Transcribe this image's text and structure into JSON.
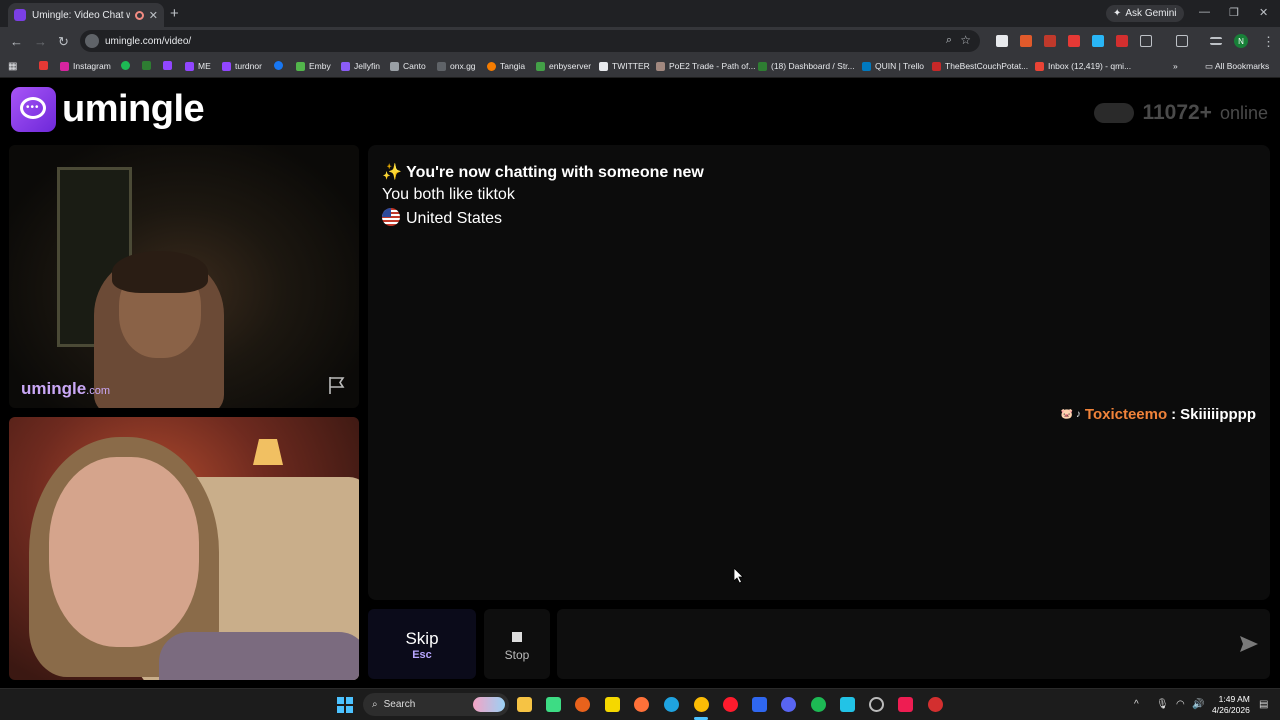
{
  "browser": {
    "tab_title": "Umingle: Video Chat with S",
    "new_tab": "+",
    "ask_gemini": "Ask Gemini",
    "url": "umingle.com/video/",
    "profile_initial": "N",
    "bookmarks": [
      "Instagram",
      "ME",
      "turdnor",
      "Emby",
      "Jellyfin",
      "Canto",
      "onx.gg",
      "Tangia",
      "enbyserver",
      "TWITTER",
      "PoE2 Trade - Path of...",
      "(18) Dashboard / Str...",
      "QUIN | Trello",
      "TheBestCouchPotat...",
      "Inbox (12,419) - qmi..."
    ],
    "all_bookmarks": "All Bookmarks"
  },
  "header": {
    "logo_text": "umingle",
    "online_count": "11072+",
    "online_label": "online"
  },
  "remote_video": {
    "watermark_main": "umingle",
    "watermark_suffix": ".com"
  },
  "chat": {
    "notice_title": "✨ You're now chatting with someone new",
    "interest_line": "You both like tiktok",
    "country": "United States",
    "messages": [
      {
        "badge": "🐷 ♪",
        "sender": "Toxicteemo",
        "text": "Skiiiiipppp"
      }
    ]
  },
  "controls": {
    "skip_label": "Skip",
    "skip_hint": "Esc",
    "stop_label": "Stop",
    "input_value": "",
    "input_placeholder": ""
  },
  "taskbar": {
    "search_label": "Search",
    "time": "1:49 AM",
    "date": "4/26/2026"
  },
  "colors": {
    "brand_purple": "#7b3fe4",
    "sender_orange": "#f0833a",
    "skip_hint": "#b7a6ff"
  }
}
